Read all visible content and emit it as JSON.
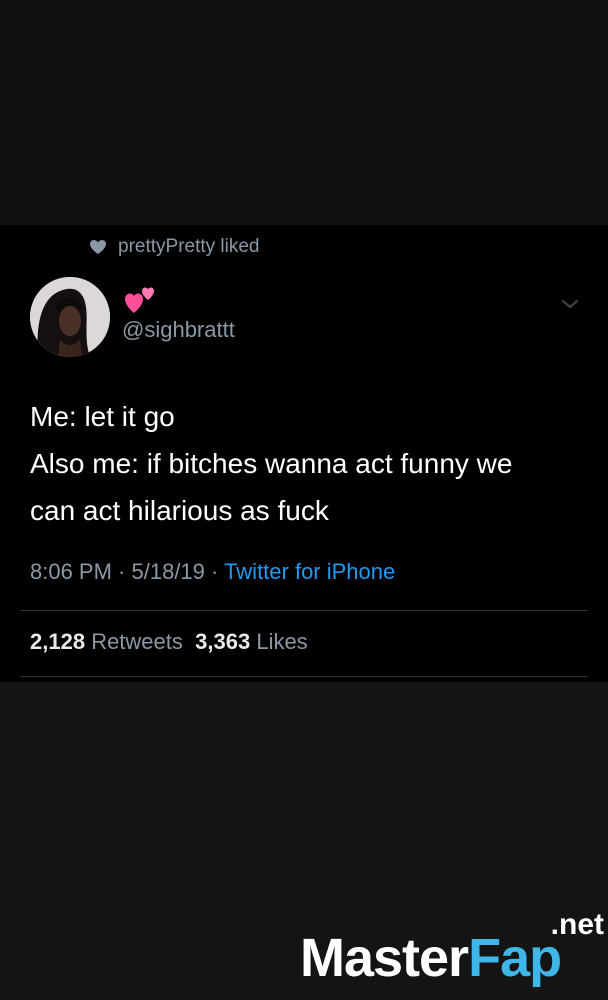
{
  "context": {
    "liked_by": "prettyPretty liked"
  },
  "tweet": {
    "handle": "@sighbrattt",
    "name_emoji": "💕",
    "text_lines": [
      "Me: let it go",
      "Also me: if bitches wanna act funny we",
      "can act hilarious as fuck"
    ],
    "time": "8:06 PM",
    "date": "5/18/19",
    "separator": " · ",
    "source": "Twitter for iPhone",
    "retweets_count": "2,128",
    "retweets_label": "Retweets",
    "likes_count": "3,363",
    "likes_label": "Likes"
  },
  "watermark": {
    "brand_part1": "Master",
    "brand_part2": "Fap",
    "tld": ".net"
  },
  "colors": {
    "muted_text": "#8b98a5",
    "link_blue": "#1d9bf0",
    "heart_pink": "#ff4f9a",
    "watermark_blue": "#3fb6e8"
  },
  "icons": {
    "liked": "heart-icon",
    "menu": "chevron-down-icon"
  }
}
